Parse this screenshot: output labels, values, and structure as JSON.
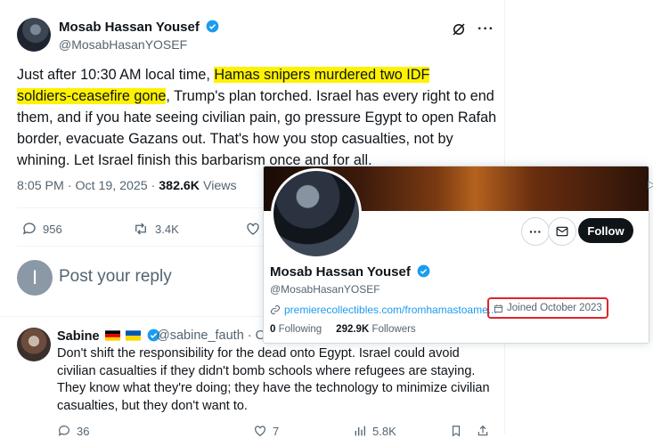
{
  "tweet": {
    "author_name": "Mosab Hassan Yousef",
    "author_handle": "@MosabHasanYOSEF",
    "text_before": "Just after 10:30 AM local time, ",
    "text_highlight_1": "Hamas snipers murdered two IDF",
    "text_highlight_2": "soldiers-ceasefire gone",
    "text_after": ", Trump's plan torched. Israel has every right to end them, and if you hate seeing civilian pain, go pressure Egypt to open Rafah border, evacuate Gazans out. That's how you stop casualties, not by whining. Let Israel finish this barbarism once and for all.",
    "timestamp": "8:05 PM · Oct 19, 2025 · ",
    "views_count": "382.6K",
    "views_label": " Views",
    "replies": "956",
    "reposts": "3.4K"
  },
  "reply_box": {
    "placeholder": "Post your reply",
    "avatar_letter": "I"
  },
  "reply": {
    "author_name": "Sabine",
    "author_handle": "@sabine_fauth · Oc",
    "text": "Don't shift the responsibility for the dead onto Egypt. Israel could avoid civilian casualties if they didn't bomb schools where refugees are staying. They know what they're doing; they have the technology to minimize civilian casualties, but they don't want to.",
    "replies": "36",
    "likes": "7",
    "views": "5.8K"
  },
  "hover_card": {
    "name": "Mosab Hassan Yousef",
    "handle": "@MosabHasanYOSEF",
    "follow_label": "Follow",
    "link": "premierecollectibles.com/fromhamastoame...",
    "joined": "Joined October 2023",
    "following_count": "0",
    "following_label": " Following",
    "followers_count": "292.9K",
    "followers_label": " Followers"
  },
  "colors": {
    "accent": "#1d9bf0",
    "highlight": "#fff200",
    "annotation": "#e0232d"
  }
}
